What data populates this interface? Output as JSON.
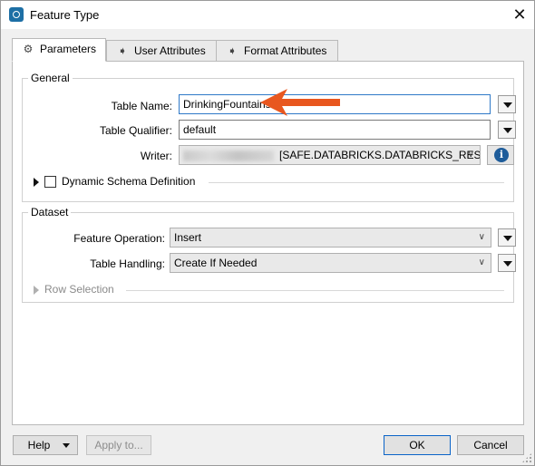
{
  "window": {
    "title": "Feature Type",
    "close_glyph": "✕"
  },
  "tabs": [
    {
      "label": "Parameters",
      "icon": "gear-icon"
    },
    {
      "label": "User Attributes",
      "icon": "arrow-tag-icon"
    },
    {
      "label": "Format Attributes",
      "icon": "arrow-tag-icon"
    }
  ],
  "general": {
    "title": "General",
    "table_name_label": "Table Name:",
    "table_name_value": "DrinkingFountains",
    "table_qualifier_label": "Table Qualifier:",
    "table_qualifier_value": "default",
    "writer_label": "Writer:",
    "writer_value": "[SAFE.DATABRICKS.DATABRICKS_REST",
    "dynamic_schema_label": "Dynamic Schema Definition"
  },
  "dataset": {
    "title": "Dataset",
    "feature_operation_label": "Feature Operation:",
    "feature_operation_value": "Insert",
    "table_handling_label": "Table Handling:",
    "table_handling_value": "Create If Needed",
    "row_selection_label": "Row Selection"
  },
  "footer": {
    "help_label": "Help",
    "apply_label": "Apply to...",
    "ok_label": "OK",
    "cancel_label": "Cancel"
  },
  "colors": {
    "accent": "#0a64c8",
    "annotation_arrow": "#e8571f",
    "info": "#1e5c9a"
  }
}
